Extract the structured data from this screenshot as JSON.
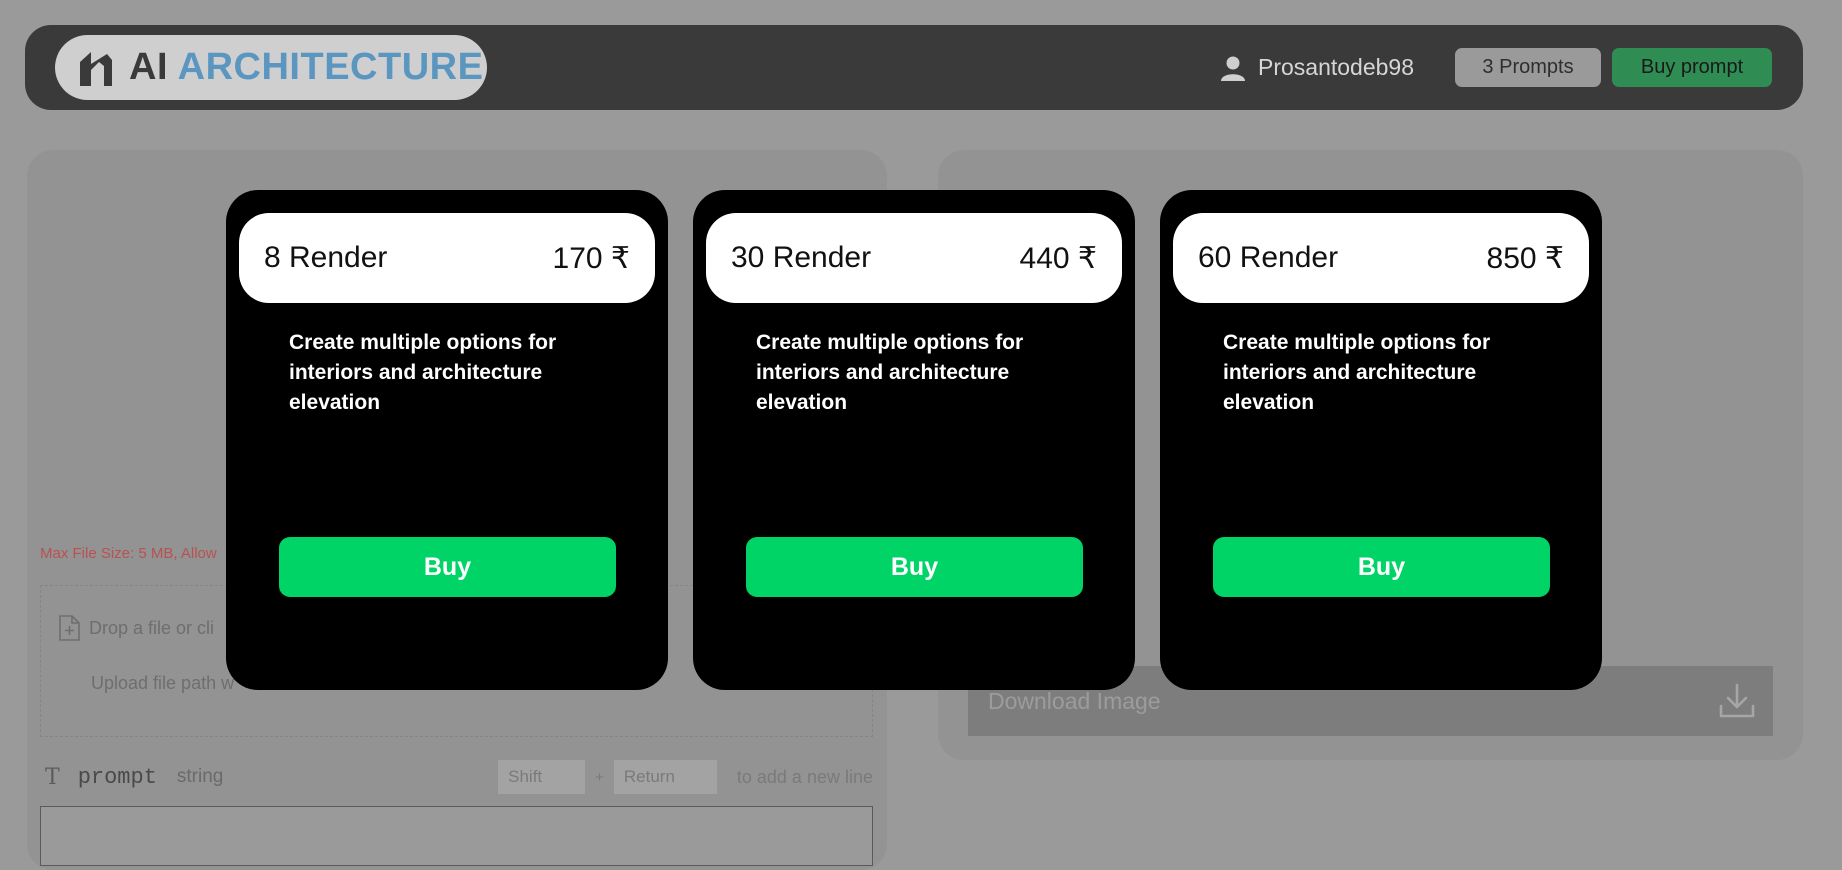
{
  "header": {
    "logo": {
      "prefix": "AI",
      "accent": "ARCHITECTURE"
    },
    "username": "Prosantodeb98",
    "prompts_badge": "3 Prompts",
    "buy_prompt_label": "Buy prompt"
  },
  "left_panel": {
    "max_file_size": "Max File Size: 5 MB, Allow",
    "dropzone_text": "Drop a file or cli",
    "upload_path_text": "Upload file path w",
    "prompt": {
      "label": "prompt",
      "type": "string",
      "key_shift": "Shift",
      "key_plus": "+",
      "key_return": "Return",
      "newline_hint": "to add a new line"
    }
  },
  "right_panel": {
    "download_label": "Download Image"
  },
  "plans": [
    {
      "name": "8 Render",
      "price": "170 ₹",
      "description": "Create multiple options for interiors and architecture elevation",
      "button": "Buy"
    },
    {
      "name": "30 Render",
      "price": "440 ₹",
      "description": "Create multiple options for interiors and architecture elevation",
      "button": "Buy"
    },
    {
      "name": "60 Render",
      "price": "850 ₹",
      "description": "Create multiple options for interiors and architecture elevation",
      "button": "Buy"
    }
  ],
  "colors": {
    "accent_blue": "#5a96c0",
    "buy_green": "#00d466",
    "buy_prompt_green": "#2f8c52",
    "error_red": "#b85252"
  },
  "icons": [
    "logo-mark-icon",
    "user-icon",
    "file-add-icon",
    "text-type-icon",
    "download-icon"
  ]
}
